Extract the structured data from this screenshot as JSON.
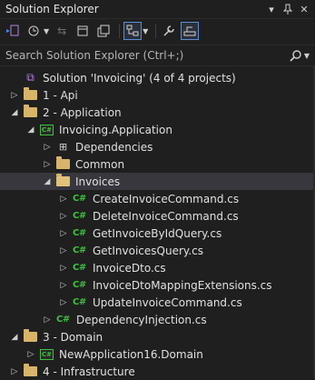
{
  "window": {
    "title": "Solution Explorer",
    "buttons": [
      "chevron-down-icon",
      "pin-icon",
      "close-icon"
    ]
  },
  "search": {
    "placeholder": "Search Solution Explorer (Ctrl+;)"
  },
  "tree": [
    {
      "label": "Solution 'Invoicing' (4 of 4 projects)",
      "icon": "solution-icon",
      "arrow": "",
      "depth": 0
    },
    {
      "label": "1 - Api",
      "icon": "folder-icon",
      "arrow": "collapsed",
      "depth": 0
    },
    {
      "label": "2 - Application",
      "icon": "folder-icon",
      "arrow": "expanded",
      "depth": 0
    },
    {
      "label": "Invoicing.Application",
      "icon": "csproj-icon",
      "arrow": "expanded",
      "depth": 1
    },
    {
      "label": "Dependencies",
      "icon": "dependencies-icon",
      "arrow": "collapsed",
      "depth": 2
    },
    {
      "label": "Common",
      "icon": "folder-icon",
      "arrow": "collapsed",
      "depth": 2
    },
    {
      "label": "Invoices",
      "icon": "folder-open-icon",
      "arrow": "expanded",
      "depth": 2,
      "selected": true
    },
    {
      "label": "CreateInvoiceCommand.cs",
      "icon": "csharp-file-icon",
      "arrow": "collapsed",
      "depth": 3
    },
    {
      "label": "DeleteInvoiceCommand.cs",
      "icon": "csharp-file-icon",
      "arrow": "collapsed",
      "depth": 3
    },
    {
      "label": "GetInvoiceByIdQuery.cs",
      "icon": "csharp-file-icon",
      "arrow": "collapsed",
      "depth": 3
    },
    {
      "label": "GetInvoicesQuery.cs",
      "icon": "csharp-file-icon",
      "arrow": "collapsed",
      "depth": 3
    },
    {
      "label": "InvoiceDto.cs",
      "icon": "csharp-file-icon",
      "arrow": "collapsed",
      "depth": 3
    },
    {
      "label": "InvoiceDtoMappingExtensions.cs",
      "icon": "csharp-file-icon",
      "arrow": "collapsed",
      "depth": 3
    },
    {
      "label": "UpdateInvoiceCommand.cs",
      "icon": "csharp-file-icon",
      "arrow": "collapsed",
      "depth": 3
    },
    {
      "label": "DependencyInjection.cs",
      "icon": "csharp-file-icon",
      "arrow": "collapsed",
      "depth": 2
    },
    {
      "label": "3 - Domain",
      "icon": "folder-icon",
      "arrow": "expanded",
      "depth": 0
    },
    {
      "label": "NewApplication16.Domain",
      "icon": "csproj-icon",
      "arrow": "collapsed",
      "depth": 1
    },
    {
      "label": "4 - Infrastructure",
      "icon": "folder-icon",
      "arrow": "collapsed",
      "depth": 0
    }
  ],
  "colors": {
    "background": "#1f1f1f",
    "selection": "#37373d",
    "folder": "#d8b46a",
    "csharp": "#3fbf3f",
    "solution": "#b480e6",
    "active_tool_border": "#5a8fd6"
  }
}
